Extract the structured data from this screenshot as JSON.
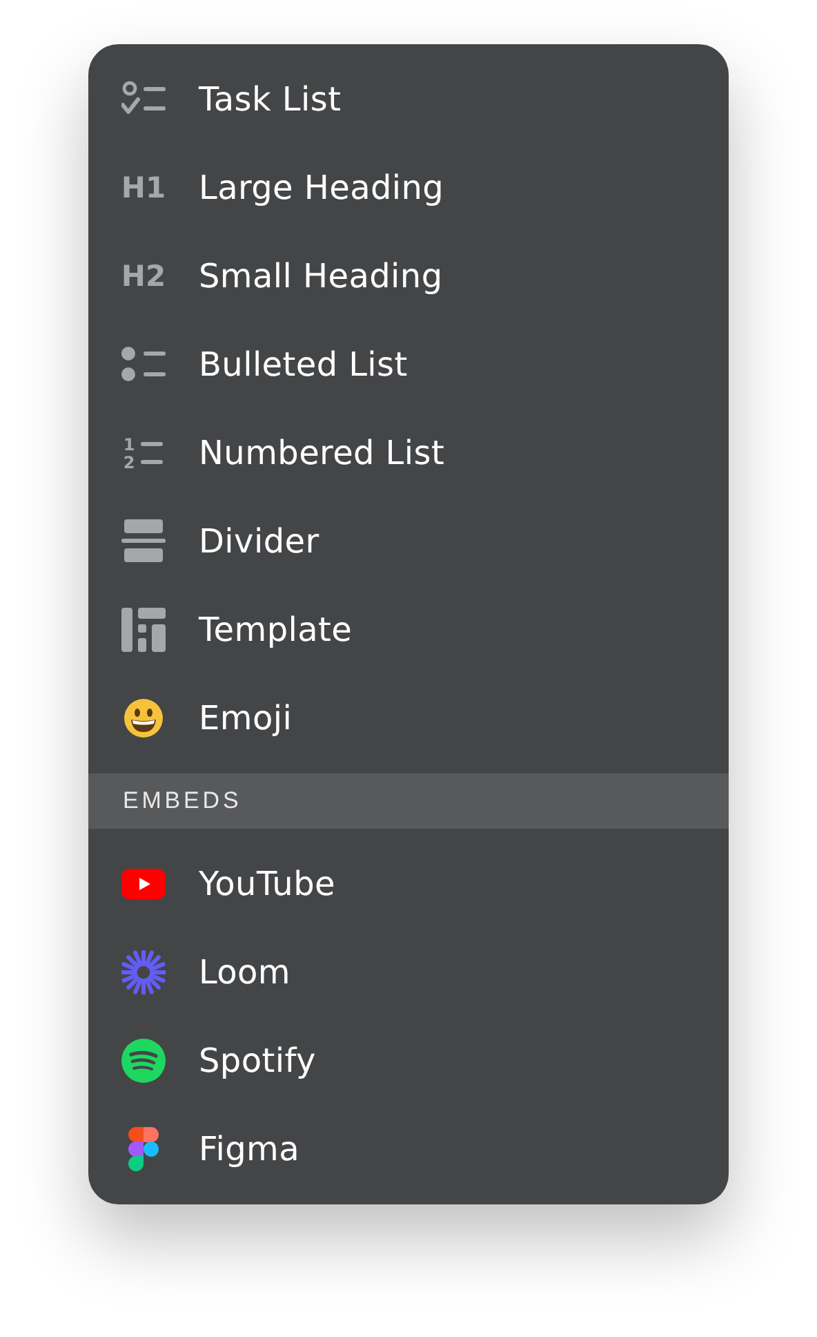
{
  "blocks": [
    {
      "kind": "tasks",
      "label": "Task List"
    },
    {
      "kind": "glyph",
      "glyph": "H1",
      "label": "Large Heading"
    },
    {
      "kind": "glyph",
      "glyph": "H2",
      "label": "Small Heading"
    },
    {
      "kind": "bullets",
      "label": "Bulleted List"
    },
    {
      "kind": "numbers",
      "digits": [
        "1",
        "2"
      ],
      "label": "Numbered List"
    },
    {
      "kind": "divider",
      "label": "Divider"
    },
    {
      "kind": "template",
      "label": "Template"
    },
    {
      "kind": "emoji",
      "label": "Emoji"
    }
  ],
  "embeds_header": "EMBEDS",
  "embeds": [
    {
      "kind": "youtube",
      "label": "YouTube"
    },
    {
      "kind": "loom",
      "label": "Loom"
    },
    {
      "kind": "spotify",
      "label": "Spotify"
    },
    {
      "kind": "figma",
      "label": "Figma"
    }
  ]
}
